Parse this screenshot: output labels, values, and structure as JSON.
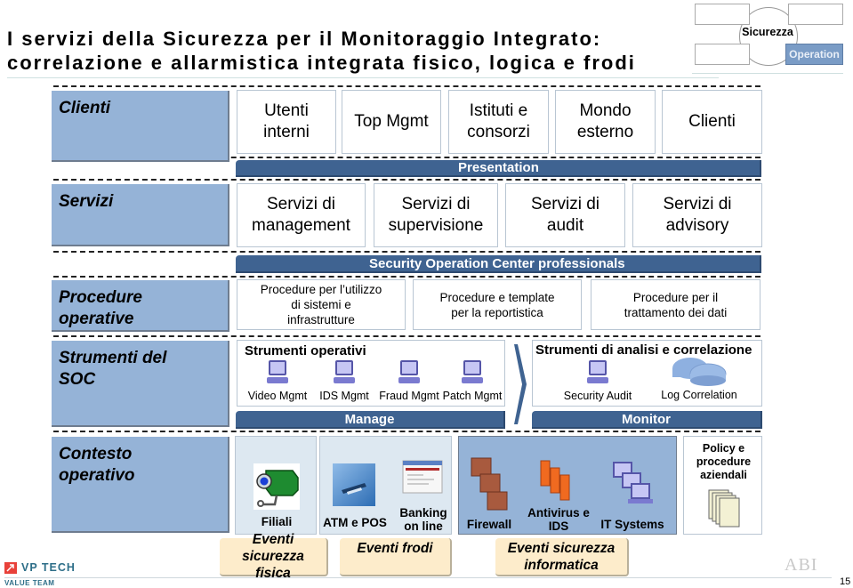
{
  "title": {
    "line1": "I servizi della Sicurezza per il Monitoraggio Integrato:",
    "line2": "correlazione e allarmistica integrata fisico, logica e frodi"
  },
  "nav_diagram": {
    "center": "Sicurezza",
    "active": "Operation",
    "active_color": "#7a9cc6"
  },
  "rows": {
    "clienti": {
      "label": "Clienti",
      "items": [
        {
          "line1": "Utenti",
          "line2": "interni"
        },
        {
          "line1": "Top Mgmt",
          "line2": ""
        },
        {
          "line1": "Istituti e",
          "line2": "consorzi"
        },
        {
          "line1": "Mondo",
          "line2": "esterno"
        },
        {
          "line1": "Clienti",
          "line2": ""
        }
      ]
    },
    "presentation_bar": "Presentation",
    "servizi": {
      "label": "Servizi",
      "items": [
        {
          "line1": "Servizi di",
          "line2": "management"
        },
        {
          "line1": "Servizi di",
          "line2": "supervisione"
        },
        {
          "line1": "Servizi di",
          "line2": "audit"
        },
        {
          "line1": "Servizi di",
          "line2": "advisory"
        }
      ]
    },
    "soc_bar": "Security Operation Center professionals",
    "procedure": {
      "label_line1": "Procedure",
      "label_line2": "operative",
      "items": [
        {
          "line1": "Procedure per l’utilizzo",
          "line2": "di sistemi e",
          "line3": "infrastrutture"
        },
        {
          "line1": "Procedure e template",
          "line2": "per la reportistica"
        },
        {
          "line1": "Procedure per il",
          "line2": "trattamento dei dati"
        }
      ]
    },
    "strumenti": {
      "label_line1": "Strumenti del",
      "label_line2": "SOC",
      "operativi": {
        "title": "Strumenti operativi",
        "tools": [
          "Video Mgmt",
          "IDS Mgmt",
          "Fraud Mgmt",
          "Patch Mgmt"
        ],
        "bar": "Manage"
      },
      "analisi": {
        "title": "Strumenti di analisi e correlazione",
        "tools": [
          "Security Audit",
          "Log Correlation"
        ],
        "bar": "Monitor"
      }
    },
    "contesto": {
      "label_line1": "Contesto",
      "label_line2": "operativo",
      "groups": [
        {
          "items": [
            {
              "label": "Filiali",
              "icon": "security-camera-icon"
            }
          ]
        },
        {
          "items": [
            {
              "label": "ATM e POS",
              "icon": "atm-icon"
            },
            {
              "label_line1": "Banking",
              "label_line2": "on line",
              "icon": "web-page-icon"
            }
          ]
        },
        {
          "items": [
            {
              "label": "Firewall",
              "icon": "firewall-icon"
            },
            {
              "label_line1": "Antivirus e",
              "label_line2": "IDS",
              "icon": "server-icon"
            },
            {
              "label": "IT Systems",
              "icon": "computers-icon"
            }
          ]
        }
      ],
      "policy": {
        "line1": "Policy  e",
        "line2": "procedure",
        "line3": "aziendali"
      }
    }
  },
  "events": [
    {
      "line1": "Eventi sicurezza",
      "line2": "fisica"
    },
    {
      "line1": "Eventi frodi",
      "line2": ""
    },
    {
      "line1": "Eventi sicurezza",
      "line2": "informatica"
    }
  ],
  "footer": {
    "brand": "VP TECH",
    "brand_sub": "VALUE TEAM",
    "partner": "ABI",
    "page_number": "15"
  },
  "colors": {
    "row_label_bg": "#95b3d7",
    "bar_bg": "#3f6391",
    "event_bg": "#fdeccb"
  }
}
